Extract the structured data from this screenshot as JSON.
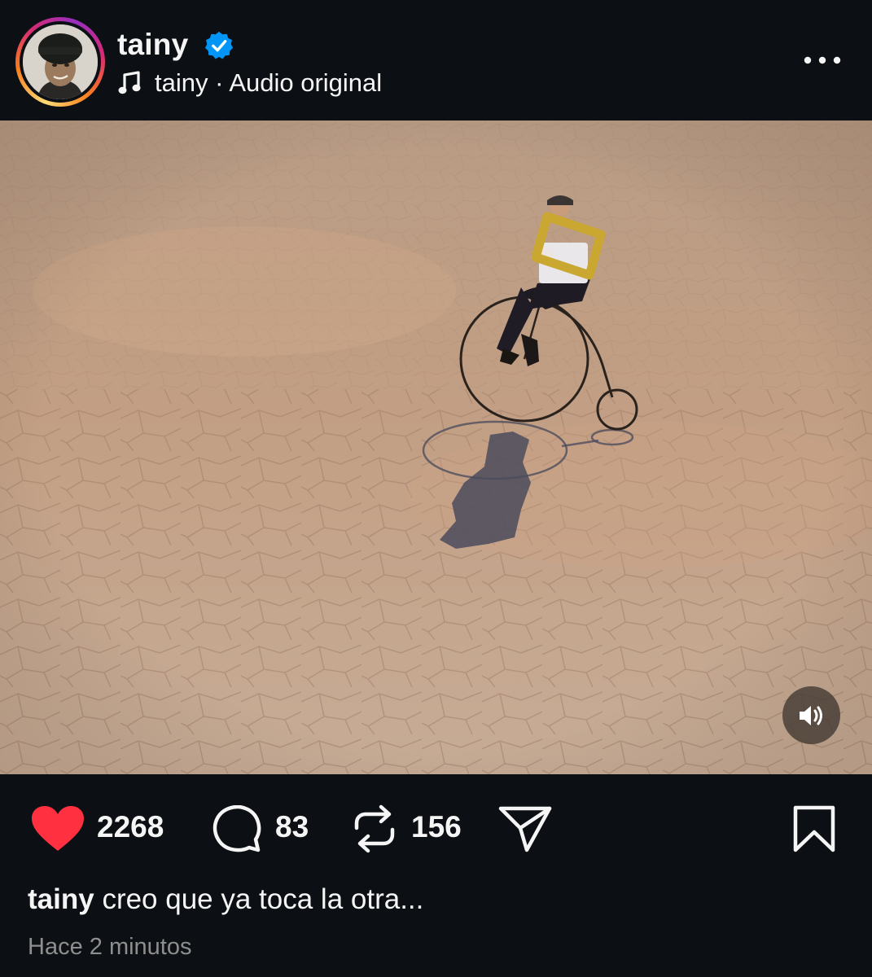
{
  "header": {
    "username": "tainy",
    "verified": true,
    "audio_user": "tainy",
    "audio_separator": " · ",
    "audio_label": "Audio original",
    "avatar_icon": "profile-avatar",
    "more_icon": "more-horizontal-icon"
  },
  "media": {
    "type": "video",
    "sound_icon": "speaker-volume-icon"
  },
  "actions": {
    "likes": "2268",
    "comments": "83",
    "reposts": "156",
    "liked": true,
    "like_color": "#ff3040",
    "like_icon": "heart-icon",
    "comment_icon": "comment-bubble-icon",
    "repost_icon": "repost-icon",
    "share_icon": "send-icon",
    "save_icon": "bookmark-icon"
  },
  "caption": {
    "username": "tainy",
    "text": "creo que ya toca la otra..."
  },
  "timestamp": "Hace 2 minutos",
  "colors": {
    "background": "#0c1014",
    "text": "#f5f5f5",
    "muted": "#8e8e8e",
    "verified_blue": "#0095f6"
  }
}
